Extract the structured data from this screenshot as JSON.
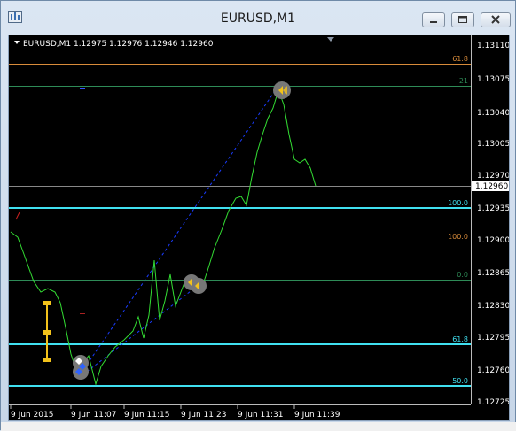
{
  "window": {
    "title": "EURUSD,M1"
  },
  "chart": {
    "header": "EURUSD,M1  1.12975 1.12976 1.12946 1.12960",
    "current_price": "1.12960",
    "price_axis": [
      "1.13110",
      "1.13075",
      "1.13040",
      "1.13005",
      "1.12970",
      "1.12935",
      "1.12900",
      "1.12865",
      "1.12830",
      "1.12795",
      "1.12760",
      "1.12725"
    ],
    "time_axis": [
      "9 Jun 2015",
      "9 Jun 11:07",
      "9 Jun 11:15",
      "9 Jun 11:23",
      "9 Jun 11:31",
      "9 Jun 11:39"
    ],
    "level_labels": {
      "upper_618": "61.8",
      "upper_21": "21",
      "cyan_100": "100.0",
      "orange_100": "100.0",
      "green_00": "0.0",
      "lower_618": "61.8",
      "lower_500": "50.0"
    },
    "colors": {
      "background": "#000000",
      "price_line": "#33dd33",
      "cyan_level": "#40e0f0",
      "orange_level": "#d88b3a",
      "green_level": "#2e8b57",
      "trend_line": "#1a3cff",
      "indicator": "#f2c21b"
    }
  }
}
